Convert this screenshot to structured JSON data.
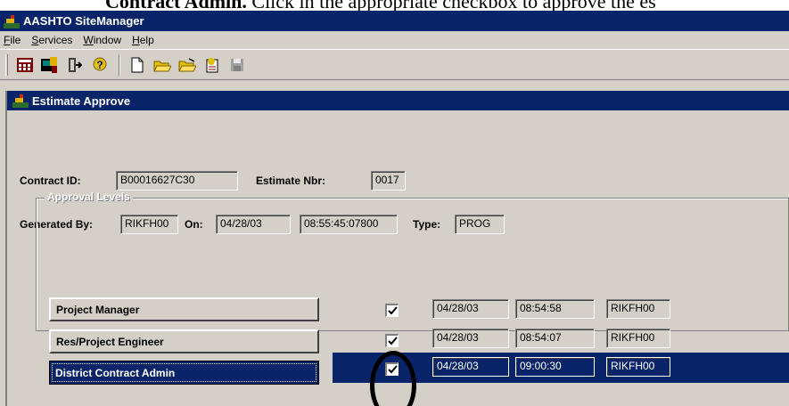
{
  "caption": {
    "bold_text": "Contract Admin.",
    "text": " Click in the appropriate checkbox to approve the es"
  },
  "app": {
    "title": "AASHTO SiteManager",
    "menu": [
      {
        "label": "File",
        "key": "F",
        "rest": "ile"
      },
      {
        "label": "Services",
        "key": "S",
        "rest": "ervices"
      },
      {
        "label": "Window",
        "key": "W",
        "rest": "indow"
      },
      {
        "label": "Help",
        "key": "H",
        "rest": "elp"
      }
    ],
    "toolbar_icons": [
      "calculator-icon",
      "contractor-icon",
      "exit-icon",
      "help-icon",
      "new-document-icon",
      "open-folder-icon",
      "open-folder-2-icon",
      "notes-icon",
      "save-icon"
    ]
  },
  "form": {
    "title": "Estimate Approve",
    "contract_id_label": "Contract ID:",
    "contract_id": "B00016627C30",
    "estimate_nbr_label": "Estimate Nbr:",
    "estimate_nbr": "0017",
    "generated_by_label": "Generated By:",
    "generated_by": "RIKFH00",
    "on_label": "On:",
    "on_date": "04/28/03",
    "on_time": "08:55:45:07800",
    "type_label": "Type:",
    "type": "PROG",
    "approval_legend": "Approval Levels",
    "levels": [
      {
        "label": "Project Manager",
        "checked": true,
        "date": "04/28/03",
        "time": "08:54:58",
        "user": "RIKFH00"
      },
      {
        "label": "Res/Project Engineer",
        "checked": true,
        "date": "04/28/03",
        "time": "08:54:07",
        "user": "RIKFH00"
      },
      {
        "label": "District Contract Admin",
        "checked": true,
        "date": "04/28/03",
        "time": "09:00:30",
        "user": "RIKFH00",
        "selected": true
      }
    ]
  },
  "colors": {
    "title_bar": "#0a246a",
    "face": "#d4d0c8"
  }
}
